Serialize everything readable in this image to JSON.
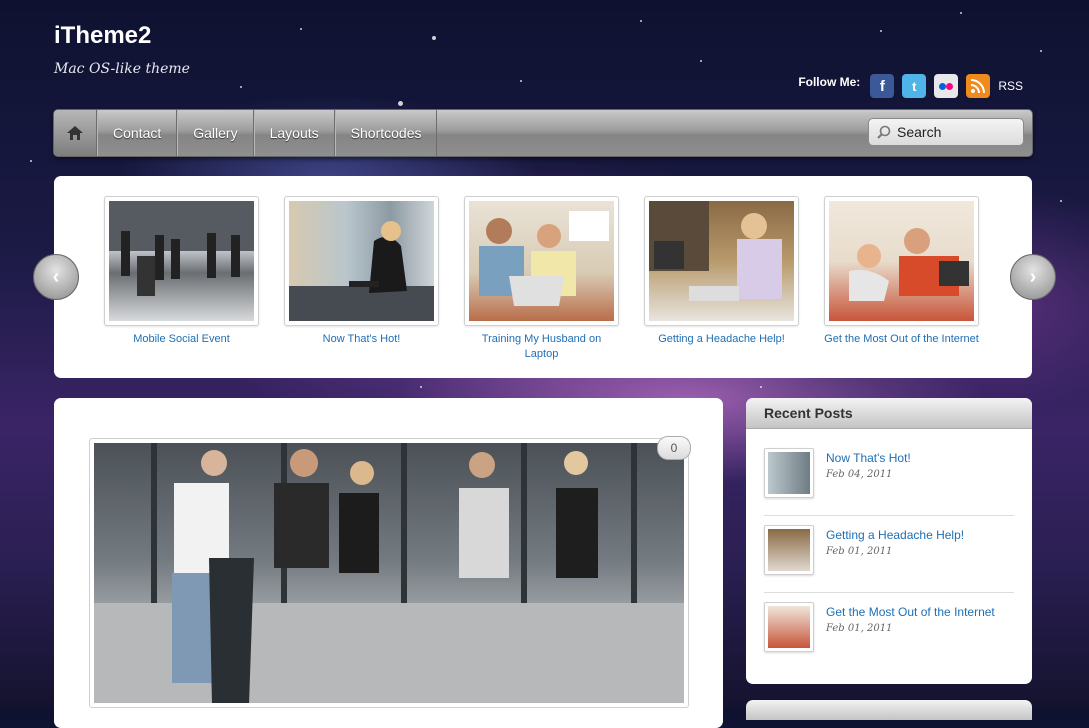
{
  "header": {
    "title": "iTheme2",
    "tagline": "Mac OS-like theme",
    "follow_label": "Follow Me:",
    "social": [
      {
        "icon": "facebook-icon",
        "glyph": "f",
        "color": "#3b5998"
      },
      {
        "icon": "twitter-icon",
        "glyph": "t",
        "color": "#4fb4e8"
      },
      {
        "icon": "flickr-icon",
        "colors": [
          "#0063dc",
          "#ff0084"
        ]
      },
      {
        "icon": "rss-icon",
        "color": "#f08a1c"
      }
    ],
    "rss_label": "RSS"
  },
  "nav": {
    "home_icon": "home-icon",
    "items": [
      "Contact",
      "Gallery",
      "Layouts",
      "Shortcodes"
    ],
    "search_placeholder": "Search"
  },
  "slider": {
    "slides": [
      {
        "caption": "Mobile Social Event"
      },
      {
        "caption": "Now That's Hot!"
      },
      {
        "caption": "Training My Husband on Laptop"
      },
      {
        "caption": "Getting a Headache Help!"
      },
      {
        "caption": "Get the Most Out of the Internet"
      }
    ],
    "prev_icon": "chevron-left-icon",
    "next_icon": "chevron-right-icon"
  },
  "content": {
    "comment_count": "0"
  },
  "sidebar": {
    "title": "Recent Posts",
    "posts": [
      {
        "title": "Now That's Hot!",
        "date": "Feb 04, 2011"
      },
      {
        "title": "Getting a Headache Help!",
        "date": "Feb 01, 2011"
      },
      {
        "title": "Get the Most Out of the Internet",
        "date": "Feb 01, 2011"
      }
    ]
  },
  "colors": {
    "link": "#1f6fb5",
    "nav_gray": "#9c9c9c"
  }
}
